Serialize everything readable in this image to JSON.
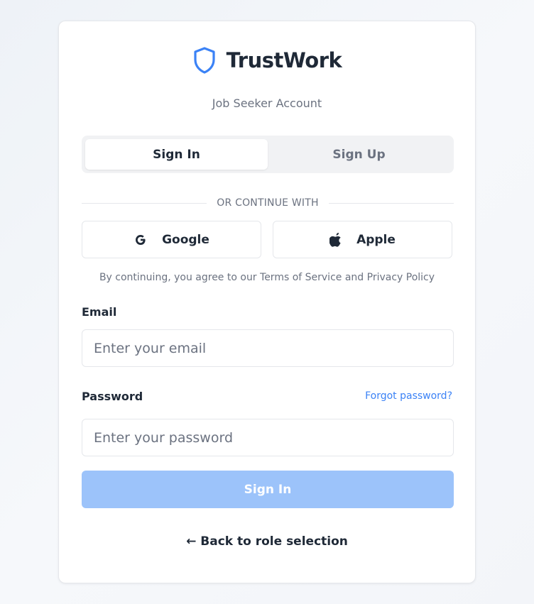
{
  "brand": {
    "name": "TrustWork",
    "icon": "shield-icon",
    "accent": "#3b82f6"
  },
  "subtitle": "Job Seeker Account",
  "tabs": [
    {
      "label": "Sign In",
      "active": true
    },
    {
      "label": "Sign Up",
      "active": false
    }
  ],
  "divider_text": "OR CONTINUE WITH",
  "social": {
    "google": {
      "label": "Google",
      "icon": "google-icon"
    },
    "apple": {
      "label": "Apple",
      "icon": "apple-icon"
    }
  },
  "terms_text": "By continuing, you agree to our Terms of Service and Privacy Policy",
  "email": {
    "label": "Email",
    "placeholder": "Enter your email",
    "value": ""
  },
  "password": {
    "label": "Password",
    "placeholder": "Enter your password",
    "value": "",
    "forgot_label": "Forgot password?"
  },
  "submit_label": "Sign In",
  "back_label": "← Back to role selection",
  "colors": {
    "submit_disabled": "#9cc3fa",
    "link": "#3b82f6"
  }
}
